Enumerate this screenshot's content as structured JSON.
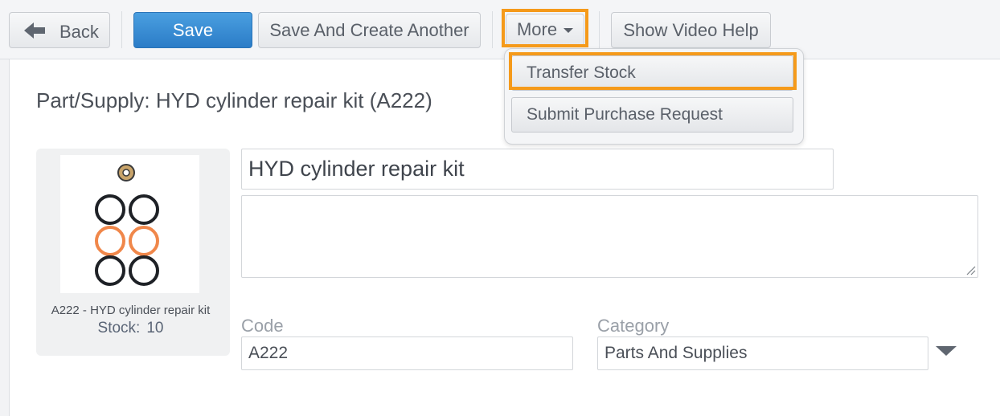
{
  "toolbar": {
    "back_label": "Back",
    "save_label": "Save",
    "save_another_label": "Save And Create Another",
    "more_label": "More",
    "video_help_label": "Show Video Help"
  },
  "more_menu": {
    "items": [
      {
        "label": "Transfer Stock"
      },
      {
        "label": "Submit Purchase Request"
      }
    ]
  },
  "page": {
    "title": "Part/Supply: HYD cylinder repair kit (A222)"
  },
  "thumbnail": {
    "caption": "A222 - HYD cylinder repair kit",
    "stock_label": "Stock:",
    "stock_value": "10"
  },
  "form": {
    "name_value": "HYD cylinder repair kit",
    "description_value": "",
    "code_label": "Code",
    "code_value": "A222",
    "category_label": "Category",
    "category_value": "Parts And Supplies"
  },
  "colors": {
    "primary": "#2b7cc7",
    "highlight": "#f59a1a",
    "ring_dark": "#1e2126",
    "ring_orange": "#f0874a"
  }
}
